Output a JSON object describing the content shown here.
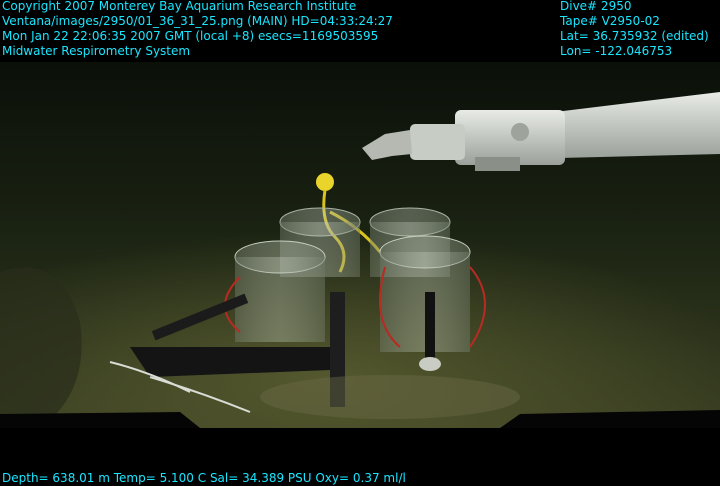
{
  "overlay": {
    "line1": "Copyright 2007 Monterey Bay Aquarium Research Institute",
    "line2": "Ventana/images/2950/01_36_31_25.png (MAIN)  HD=04:33:24:27",
    "line3": "Mon Jan 22 22:06:35 2007 GMT (local +8)  esecs=1169503595",
    "line4": "Midwater Respirometry System",
    "dive": "Dive# 2950",
    "tape": "Tape# V2950-02",
    "lat": "Lat= 36.735932 (edited)",
    "lon": "Lon= -122.046753",
    "sensors": "Depth= 638.01 m  Temp= 5.100 C  Sal= 34.389 PSU  Oxy= 0.37 ml/l"
  },
  "colors": {
    "overlay_text": "#19e6ff",
    "background": "#000000"
  }
}
